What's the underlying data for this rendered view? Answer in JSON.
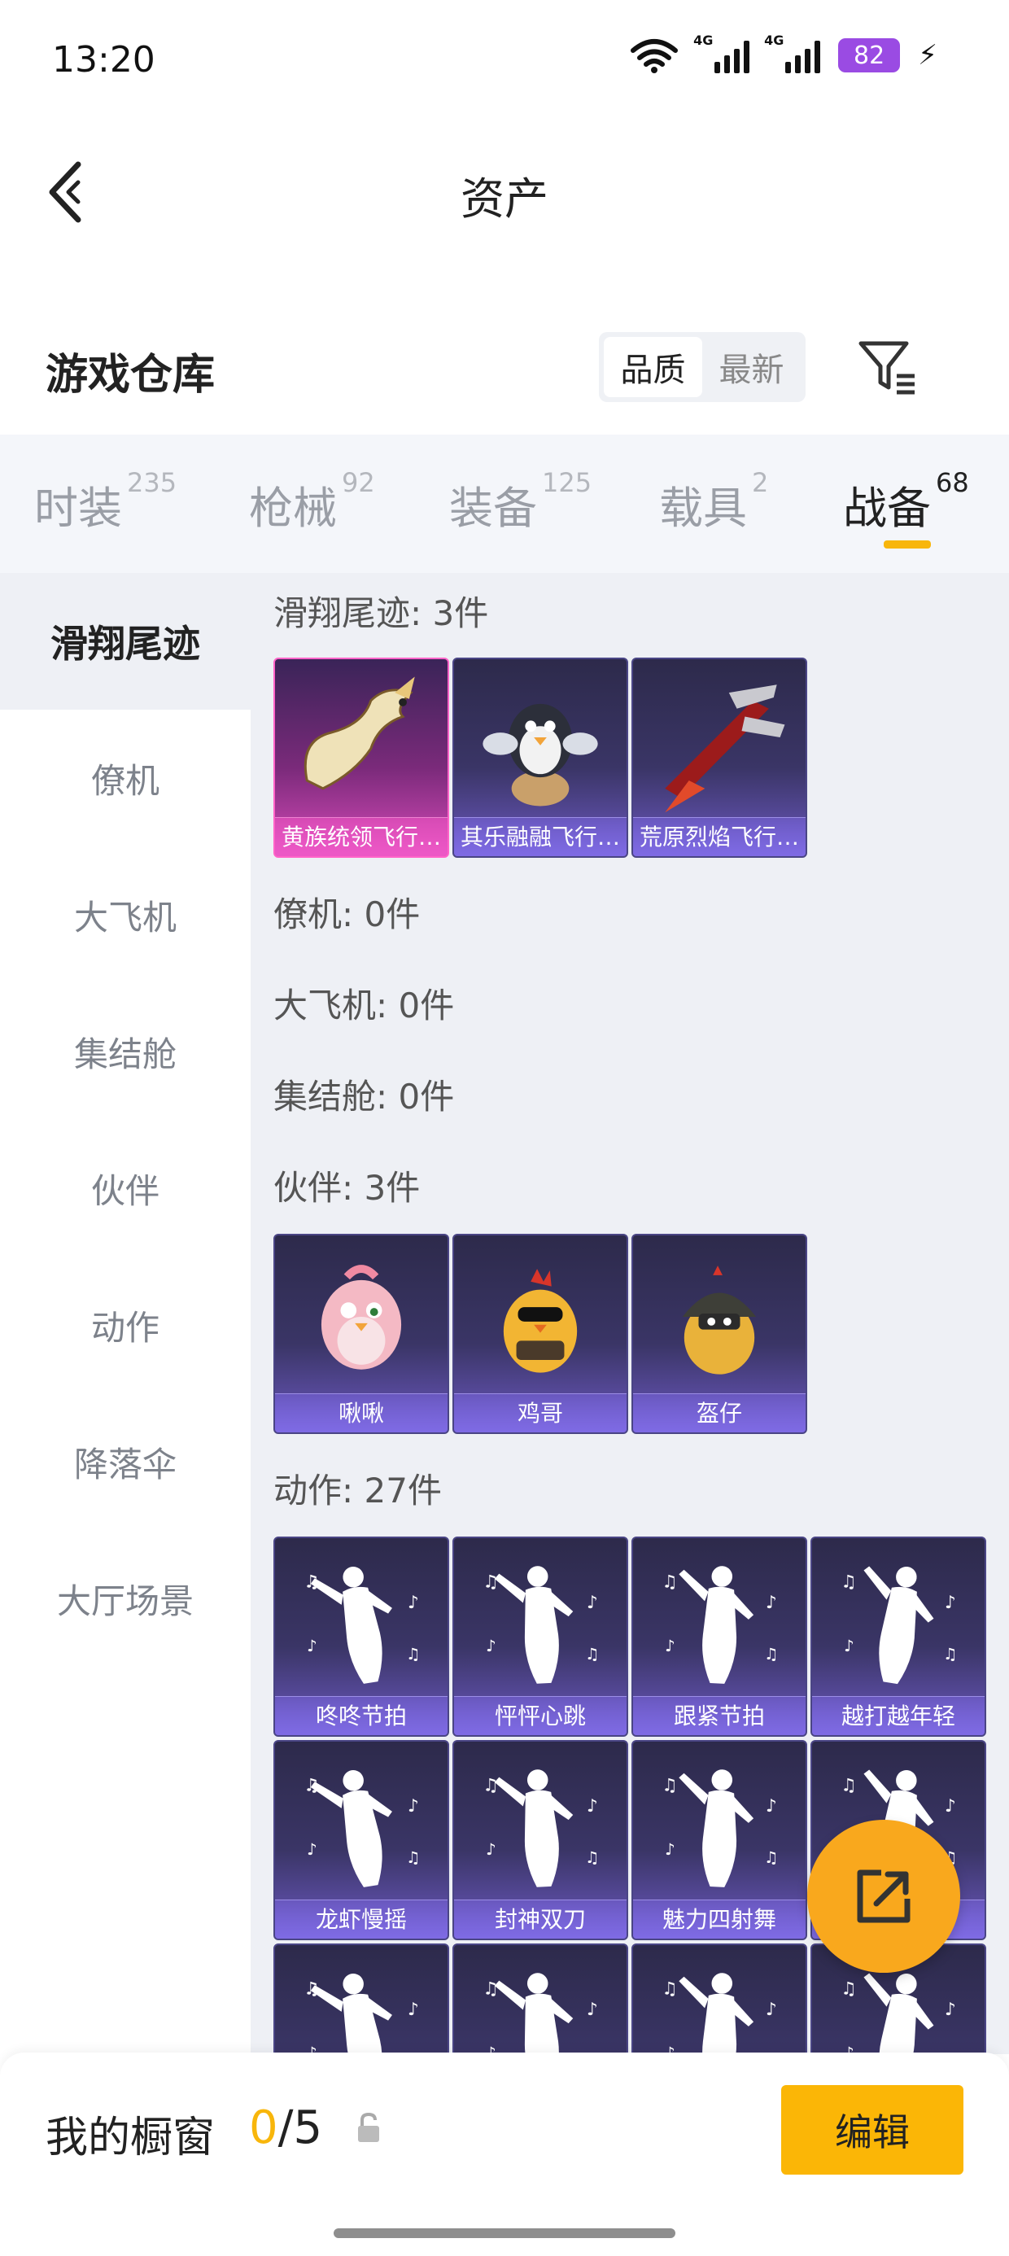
{
  "status_bar": {
    "time": "13:20",
    "battery": "82",
    "sim1": "4G",
    "sim2": "4G"
  },
  "header": {
    "title": "资产"
  },
  "warehouse": {
    "title": "游戏仓库",
    "sort_options": [
      "品质",
      "最新"
    ],
    "active_sort": "品质"
  },
  "tabs": [
    {
      "label": "时装",
      "count": "235",
      "active": false
    },
    {
      "label": "枪械",
      "count": "92",
      "active": false
    },
    {
      "label": "装备",
      "count": "125",
      "active": false
    },
    {
      "label": "载具",
      "count": "2",
      "active": false
    },
    {
      "label": "战备",
      "count": "68",
      "active": true
    }
  ],
  "sidebar": {
    "items": [
      {
        "label": "滑翔尾迹",
        "active": true
      },
      {
        "label": "僚机",
        "active": false
      },
      {
        "label": "大飞机",
        "active": false
      },
      {
        "label": "集结舱",
        "active": false
      },
      {
        "label": "伙伴",
        "active": false
      },
      {
        "label": "动作",
        "active": false
      },
      {
        "label": "降落伞",
        "active": false
      },
      {
        "label": "大厅场景",
        "active": false
      }
    ]
  },
  "sections": {
    "glide": {
      "label": "滑翔尾迹: 3件",
      "items": [
        "黄族统领飞行…",
        "其乐融融飞行…",
        "荒原烈焰飞行…"
      ]
    },
    "wingman": {
      "label": "僚机: 0件"
    },
    "plane": {
      "label": "大飞机: 0件"
    },
    "pod": {
      "label": "集结舱: 0件"
    },
    "partner": {
      "label": "伙伴: 3件",
      "items": [
        "啾啾",
        "鸡哥",
        "盔仔"
      ]
    },
    "emote": {
      "label": "动作: 27件",
      "items": [
        "咚咚节拍",
        "怦怦心跳",
        "跟紧节拍",
        "越打越年轻",
        "龙虾慢摇",
        "封神双刀",
        "魅力四射舞",
        "",
        "",
        "",
        "",
        ""
      ]
    }
  },
  "showcase": {
    "label": "我的橱窗",
    "current": "0",
    "total": "/5",
    "edit_label": "编辑"
  },
  "colors": {
    "accent": "#f8b60b",
    "fab": "#f9a81d",
    "battery": "#9a4be3"
  }
}
